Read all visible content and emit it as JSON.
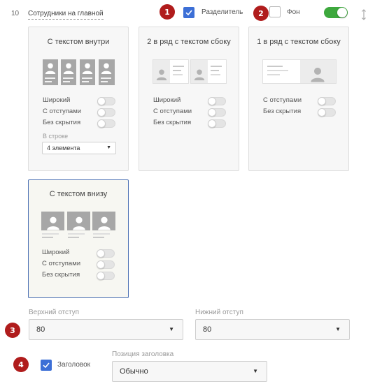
{
  "header": {
    "row_number": "10",
    "section_title": "Сотрудники на главной",
    "divider_label": "Разделитель",
    "divider_checked": true,
    "background_label": "Фон",
    "background_checked": false,
    "enabled": true
  },
  "markers": [
    "1",
    "2",
    "3",
    "4"
  ],
  "layouts": [
    {
      "title": "С текстом внутри",
      "options": [
        "Широкий",
        "С отступами",
        "Без скрытия"
      ],
      "per_row_caption": "В строке",
      "per_row_value": "4 элемента",
      "selected": false
    },
    {
      "title": "2 в ряд с текстом сбоку",
      "options": [
        "Широкий",
        "С отступами",
        "Без скрытия"
      ],
      "selected": false
    },
    {
      "title": "1 в ряд с текстом сбоку",
      "options": [
        "С отступами",
        "Без скрытия"
      ],
      "selected": false
    },
    {
      "title": "С текстом внизу",
      "options": [
        "Широкий",
        "С отступами",
        "Без скрытия"
      ],
      "selected": true
    }
  ],
  "spacing": {
    "top_caption": "Верхний отступ",
    "top_value": "80",
    "bottom_caption": "Нижний отступ",
    "bottom_value": "80"
  },
  "heading": {
    "label": "Заголовок",
    "checked": true,
    "position_caption": "Позиция заголовка",
    "position_value": "Обычно"
  },
  "colors": {
    "accent": "#3c6fd6",
    "marker": "#b01c1c",
    "toggle_on": "#3da83d",
    "selected_border": "#4a6fb3"
  }
}
